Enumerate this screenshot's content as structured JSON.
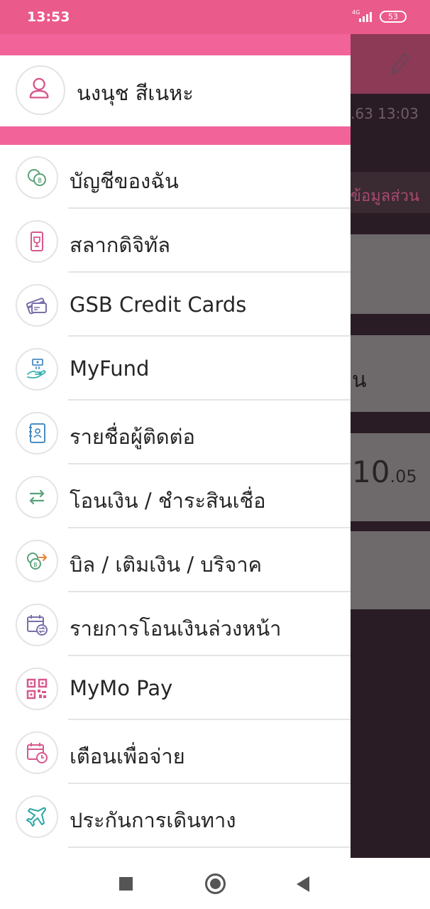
{
  "status_bar": {
    "time": "13:53",
    "network": "4G",
    "battery": "53"
  },
  "background_screen": {
    "date_partial": ".63 13:03",
    "section_partial": "ข้อมูลส่วน",
    "card2_partial": "น",
    "amount_main": "10",
    "amount_decimal": ".05"
  },
  "profile": {
    "name": "นงนุช สีเนหะ"
  },
  "menu": {
    "items": [
      {
        "label": "บัญชีของฉัน",
        "icon": "coins-icon"
      },
      {
        "label": "สลากดิจิทัล",
        "icon": "lottery-ticket-icon"
      },
      {
        "label": "GSB Credit Cards",
        "icon": "credit-card-icon"
      },
      {
        "label": "MyFund",
        "icon": "fund-hand-icon"
      },
      {
        "label": "รายชื่อผู้ติดต่อ",
        "icon": "contact-book-icon"
      },
      {
        "label": "โอนเงิน / ชำระสินเชื่อ",
        "icon": "transfer-arrows-icon"
      },
      {
        "label": "บิล / เติมเงิน / บริจาค",
        "icon": "bill-payment-icon"
      },
      {
        "label": "รายการโอนเงินล่วงหน้า",
        "icon": "scheduled-transfer-icon"
      },
      {
        "label": "MyMo Pay",
        "icon": "qr-code-icon"
      },
      {
        "label": "เตือนเพื่อจ่าย",
        "icon": "calendar-reminder-icon"
      },
      {
        "label": "ประกันการเดินทาง",
        "icon": "airplane-icon"
      }
    ]
  },
  "colors": {
    "accent": "#f2639a",
    "status_bar": "#ea5a8b",
    "icon_green": "#5aa27a",
    "icon_pink": "#d8578c",
    "icon_blue": "#4a8cc2"
  }
}
